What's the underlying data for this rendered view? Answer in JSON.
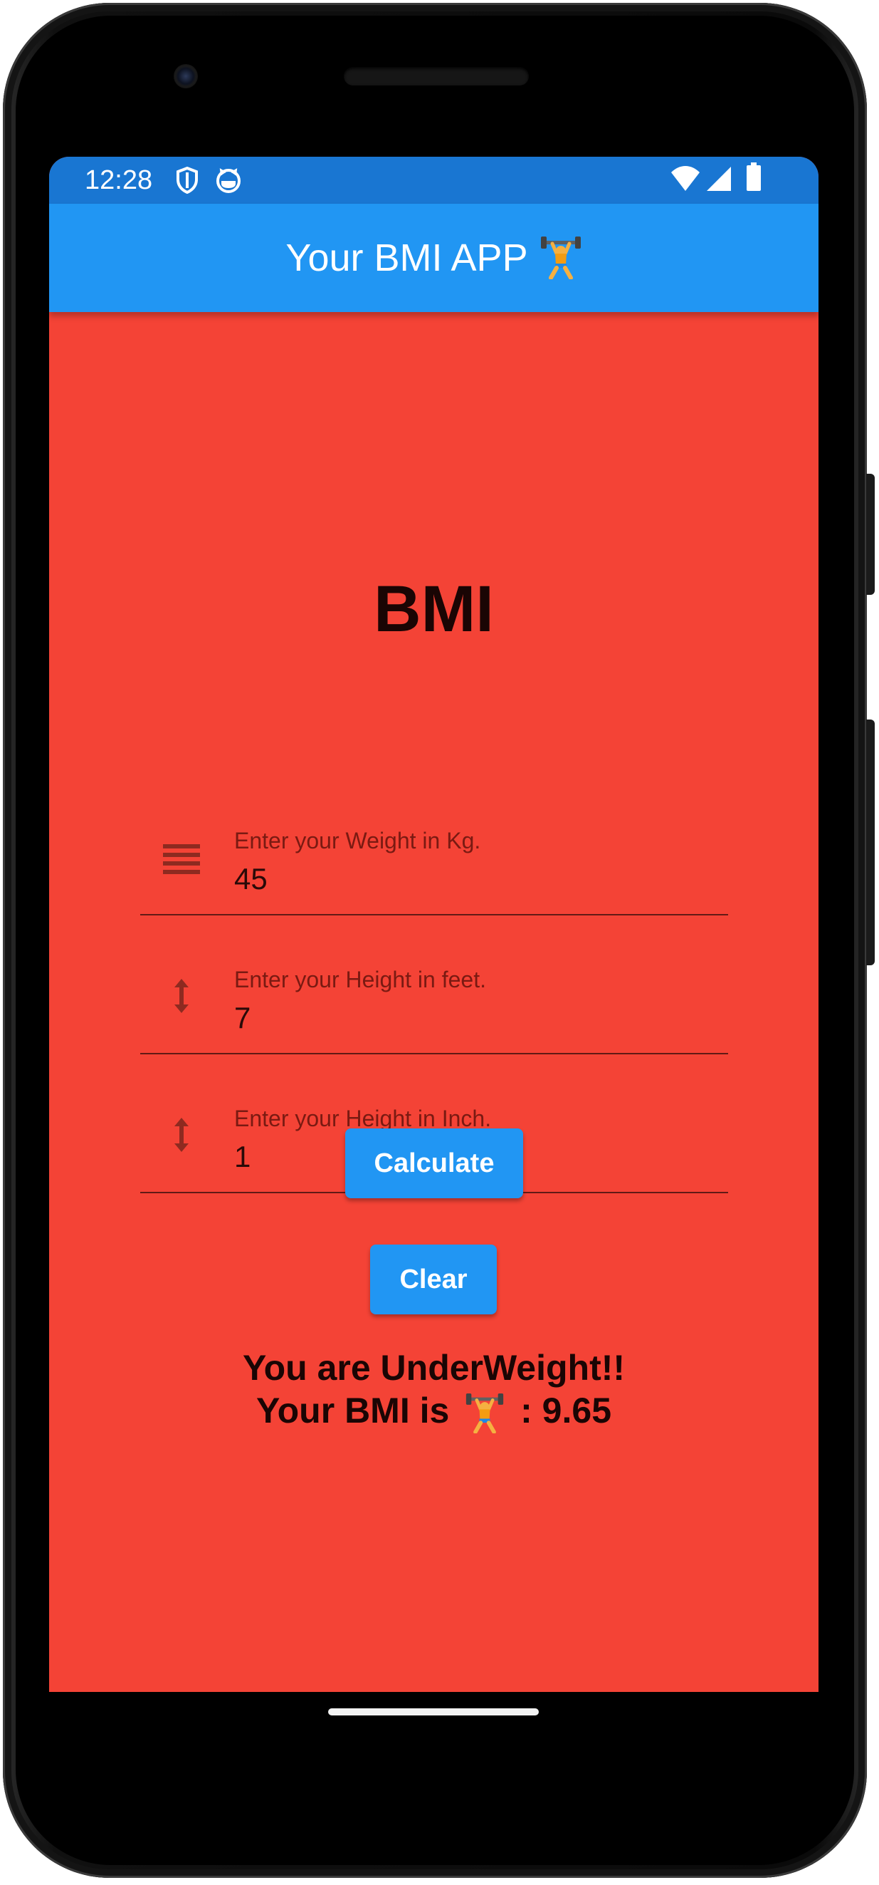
{
  "status_bar": {
    "time": "12:28",
    "icons": [
      "shield-icon",
      "cat-face-icon",
      "wifi-icon",
      "signal-icon",
      "battery-icon"
    ],
    "color": "#1976d2"
  },
  "app_bar": {
    "title": "Your BMI APP",
    "emoji_icon": "weightlifter-icon",
    "color": "#2196f3"
  },
  "main": {
    "background": "#f44336",
    "heading": "BMI",
    "fields": [
      {
        "label": "Enter your Weight in Kg.",
        "value": "45",
        "icon": "weight-lines-icon"
      },
      {
        "label": "Enter your Height in feet.",
        "value": "7",
        "icon": "height-arrow-icon"
      },
      {
        "label": "Enter your Height in Inch.",
        "value": "1",
        "icon": "height-arrow-icon"
      }
    ],
    "calculate_label": "Calculate",
    "clear_label": "Clear",
    "result_line1": "You are UnderWeight!!",
    "result_line2_prefix": "Your BMI is",
    "result_line2_suffix": ": 9.65"
  }
}
